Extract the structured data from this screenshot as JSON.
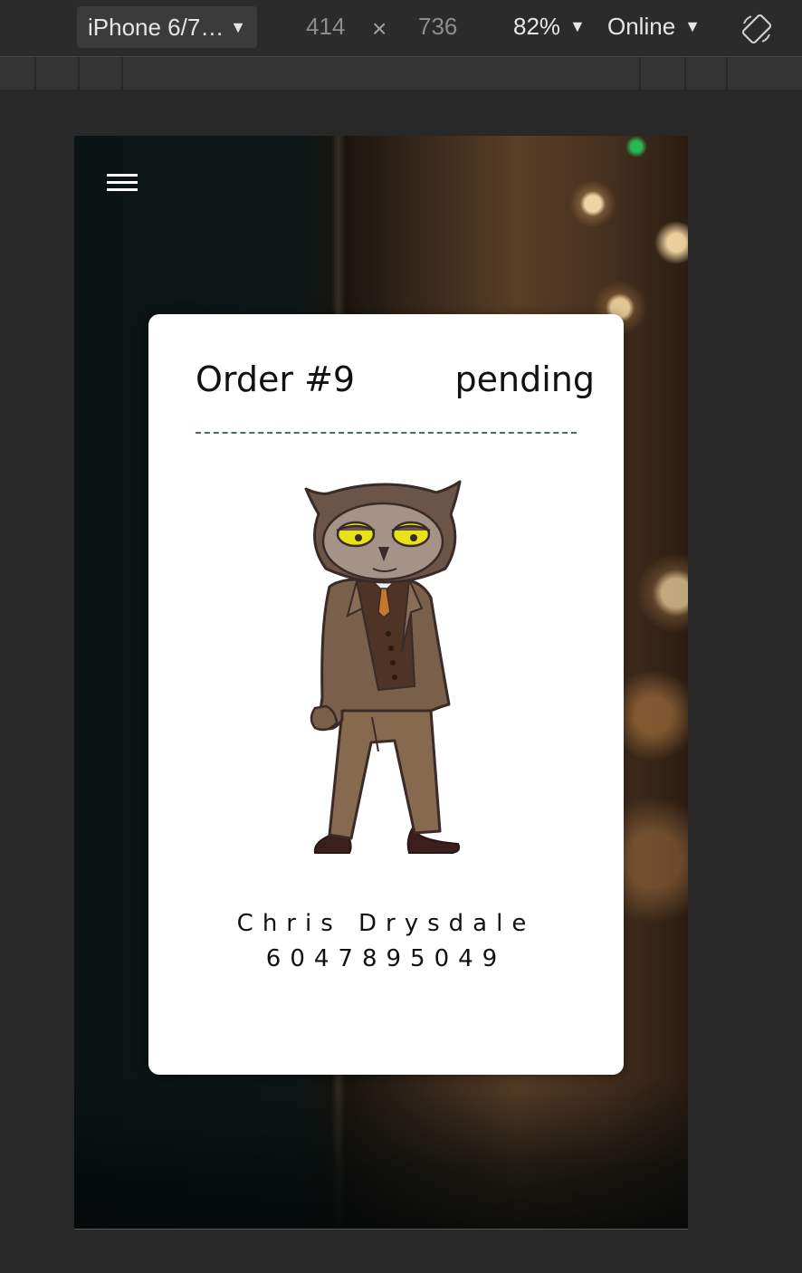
{
  "devtools": {
    "device": "iPhone 6/7…",
    "width": "414",
    "times": "×",
    "height": "736",
    "zoom": "82%",
    "network": "Online",
    "caret": "▼"
  },
  "app": {
    "order": {
      "title": "Order #9",
      "status": "pending"
    },
    "customer": {
      "name": "Chris Drysdale",
      "phone": "6047895049"
    }
  },
  "colors": {
    "card_background": "#ffffff",
    "divider": "#4d6a66",
    "text": "#111111"
  }
}
